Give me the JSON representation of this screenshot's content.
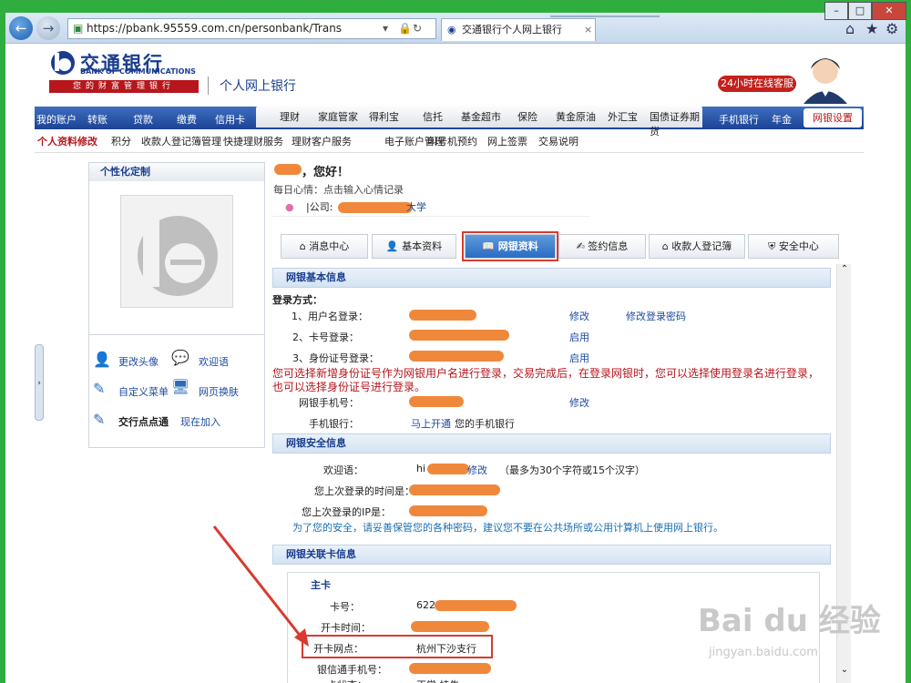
{
  "browser": {
    "url": "https://pbank.95559.com.cn/personbank/Trans",
    "tab_title": "交通银行个人网上银行",
    "tab_close": "×",
    "win_min": "–",
    "win_max": "□",
    "win_close": "✕"
  },
  "header": {
    "bank_name": "交通银行",
    "bank_name_en": "BANK OF COMMUNICATIONS",
    "slogan": "您的财富管理银行",
    "page_title": "个人网上银行",
    "service_badge": "24小时在线客服"
  },
  "main_nav": [
    "我的账户",
    "转账",
    "贷款",
    "缴费",
    "信用卡",
    "理财",
    "家庭管家",
    "得利宝",
    "信托",
    "基金超市",
    "保险",
    "黄金原油",
    "外汇宝",
    "国债证券期货",
    "手机银行",
    "年金",
    "网银设置"
  ],
  "sub_nav": [
    "个人资料修改",
    "积分",
    "收款人登记簿管理",
    "快捷理财服务",
    "理财客户服务",
    "电子账户管理",
    "叫号机预约",
    "网上签票",
    "交易说明"
  ],
  "left_panel": {
    "title": "个性化定制",
    "items": [
      {
        "label": "更改头像",
        "icon": "person-icon"
      },
      {
        "label": "欢迎语",
        "icon": "speech-icon"
      },
      {
        "label": "自定义菜单",
        "icon": "edit-icon"
      },
      {
        "label": "网页换肤",
        "icon": "monitor-icon"
      },
      {
        "label": "交行点点通",
        "icon": "edit-icon"
      },
      {
        "label": "现在加入",
        "icon": ""
      }
    ]
  },
  "greeting": "，您好！",
  "mood": "每日心情：点击输入心情记录",
  "company_prefix": "|公司:",
  "company_suffix": "大学",
  "tabs": [
    "消息中心",
    "基本资料",
    "网银资料",
    "签约信息",
    "收款人登记簿",
    "安全中心"
  ],
  "sections": {
    "basic": {
      "title": "网银基本信息",
      "login_method": "登录方式：",
      "row1_label": "1、用户名登录：",
      "row1_action1": "修改",
      "row1_action2": "修改登录密码",
      "row2_label": "2、卡号登录：",
      "row2_status": "启用",
      "row3_label": "3、身份证号登录：",
      "row3_status": "启用",
      "warning": "您可选择新增身份证号作为网银用户名进行登录，交易完成后，在登录网银时，您可以选择使用登录名进行登录，也可以选择身份证号进行登录。",
      "mobile_label": "网银手机号：",
      "mobile_action": "修改",
      "mobile_bank_label": "手机银行：",
      "mobile_bank_action": "马上开通",
      "mobile_bank_desc": "您的手机银行"
    },
    "security": {
      "title": "网银安全信息",
      "welcome_label": "欢迎语：",
      "welcome_value": "hi",
      "welcome_action": "修改",
      "welcome_hint": "（最多为30个字符或15个汉字）",
      "last_time_label": "您上次登录的时间是：",
      "last_ip_label": "您上次登录的IP是：",
      "notice": "为了您的安全，请妥善保管您的各种密码，建议您不要在公共场所或公用计算机上使用网上银行。"
    },
    "cards": {
      "title": "网银关联卡信息",
      "main_card": "主卡",
      "card_no_label": "卡号：",
      "card_no_value": "622",
      "open_time_label": "开卡时间：",
      "open_branch_label": "开卡网点：",
      "open_branch_value": "杭州下沙支行",
      "mobile_label": "银信通手机号：",
      "status_label": "卡状态：",
      "status_value": "正常  挂失"
    }
  },
  "watermark": {
    "main": "Bai du 经验",
    "sub": "jingyan.baidu.com"
  },
  "colors": {
    "brand_blue": "#1a3d8f",
    "brand_red": "#b6161c",
    "highlight": "#d93a2f",
    "redaction": "#f0883b"
  }
}
